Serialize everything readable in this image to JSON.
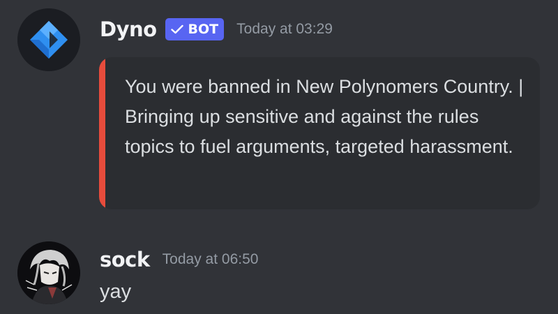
{
  "messages": [
    {
      "username": "Dyno",
      "badge": "BOT",
      "timestamp": "Today at 03:29",
      "embed": {
        "description": "You were banned in New Polynomers Country. | Bringing up sensitive and against the rules topics to fuel arguments, targeted harassment.",
        "accent_color": "#e74c3c"
      },
      "avatar_icon": "dyno-logo-icon"
    },
    {
      "username": "sock",
      "timestamp": "Today at 06:50",
      "content": "yay",
      "avatar_icon": "anime-avatar-icon"
    }
  ],
  "colors": {
    "background": "#313338",
    "embed_background": "#2b2d31",
    "badge": "#5865f2",
    "username": "#f2f3f5",
    "timestamp": "#949ba4",
    "text": "#dbdee1"
  }
}
